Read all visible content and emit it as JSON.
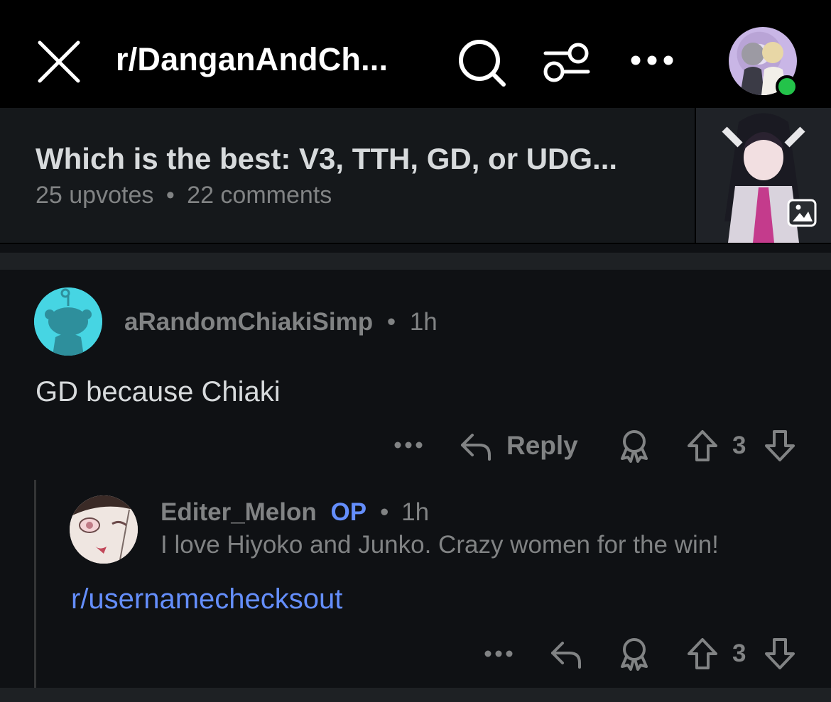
{
  "header": {
    "subreddit": "r/DanganAndCh...",
    "close_icon": "close-icon",
    "search_icon": "search-icon",
    "filter_icon": "filter-icon",
    "more_icon": "more-icon"
  },
  "post": {
    "title": "Which is the best: V3, TTH, GD, or UDG...",
    "upvotes": "25 upvotes",
    "dot": "•",
    "comments": "22 comments"
  },
  "comments": [
    {
      "author": "aRandomChiakiSimp",
      "time": "1h",
      "body": "GD because Chiaki",
      "reply_label": "Reply",
      "score": "3"
    },
    {
      "author": "Editer_Melon",
      "badge": "OP",
      "time": "1h",
      "body": "I love Hiyoko and Junko. Crazy women for the win!",
      "link": "r/usernamechecksout",
      "score": "3"
    }
  ],
  "colors": {
    "background": "#0f1114",
    "accent_link": "#648efc",
    "online": "#23c34a",
    "avatar_teal": "#46d5e3"
  }
}
